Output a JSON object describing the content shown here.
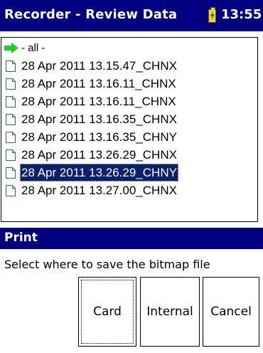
{
  "window": {
    "title": "Recorder - Review Data",
    "time": "13:55"
  },
  "list": {
    "all_label": "- all -",
    "items": [
      "28 Apr 2011 13.15.47_CHNX",
      "28 Apr 2011 13.16.11_CHNX",
      "28 Apr 2011 13.16.11_CHNX",
      "28 Apr 2011 13.16.35_CHNX",
      "28 Apr 2011 13.16.35_CHNY",
      "28 Apr 2011 13.26.29_CHNX",
      "28 Apr 2011 13.26.29_CHNY",
      "28 Apr 2011 13.27.00_CHNX"
    ],
    "selected_index": 6
  },
  "dialog": {
    "title": "Print",
    "message": "Select where to save the bitmap file",
    "buttons": {
      "card": "Card",
      "internal": "Internal",
      "cancel": "Cancel"
    }
  },
  "colors": {
    "titlebar": "#000080",
    "selection": "#0a1f6e",
    "arrow": "#20d020",
    "battery": "#ffd21a"
  }
}
